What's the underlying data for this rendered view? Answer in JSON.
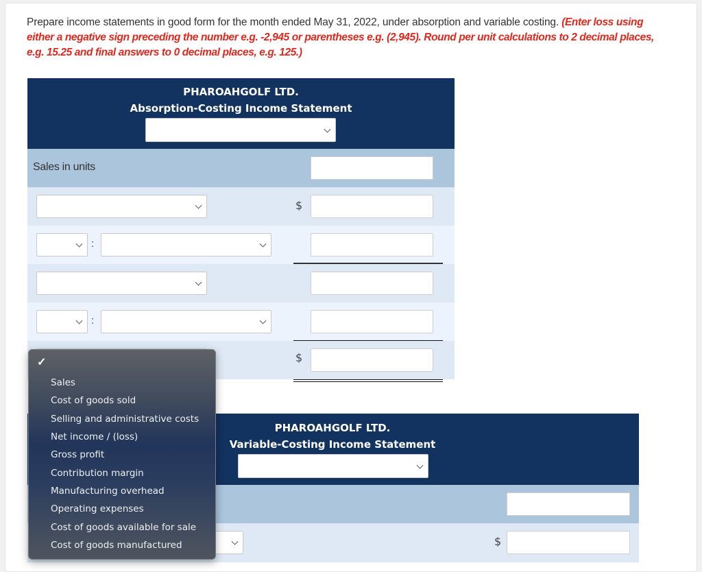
{
  "instructions": {
    "main": "Prepare income statements in good form for the month ended May 31, 2022, under absorption and variable costing. ",
    "note": "(Enter loss using either a negative sign preceding the number e.g. -2,945 or parentheses e.g. (2,945). Round per unit calculations to 2 decimal places, e.g. 15.25 and final answers to 0 decimal places, e.g. 125.)"
  },
  "absorption": {
    "company": "PHAROAHGOLF LTD.",
    "title": "Absorption-Costing Income Statement",
    "period_select": "",
    "sales_units_label": "Sales in units",
    "sales_units_value": "",
    "currency_symbol": "$",
    "rows": [
      {
        "type": "select",
        "value": "",
        "amount": "",
        "dollar": true
      },
      {
        "type": "split",
        "prefix": "",
        "value": "",
        "amount": "",
        "separator": ":"
      },
      {
        "type": "select",
        "value": "",
        "amount": ""
      },
      {
        "type": "split",
        "prefix": "",
        "value": "",
        "amount": "",
        "separator": ":"
      },
      {
        "type": "select",
        "value": "",
        "amount": "",
        "dollar": true
      }
    ]
  },
  "variable": {
    "company": "PHAROAHGOLF LTD.",
    "title": "Variable-Costing Income Statement",
    "period_select": "",
    "sales_units_value": "",
    "currency_symbol": "$",
    "rows": [
      {
        "type": "select",
        "value": "",
        "amount": "",
        "dollar": true
      }
    ]
  },
  "dropdown": {
    "selected": "",
    "options": [
      "Sales",
      "Cost of goods sold",
      "Selling and administrative costs",
      "Net income / (loss)",
      "Gross profit",
      "Contribution margin",
      "Manufacturing overhead",
      "Operating expenses",
      "Cost of goods available for sale",
      "Cost of goods manufactured"
    ]
  }
}
